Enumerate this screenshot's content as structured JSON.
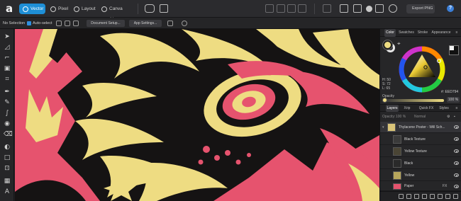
{
  "topbar": {
    "logo": "a",
    "personas": [
      "Vector",
      "Pixel",
      "Layout",
      "Canva AI"
    ],
    "export_label": "Export PNG",
    "help_label": "?"
  },
  "context": {
    "selection": "No Selection",
    "auto_select": "Auto-select",
    "document_setup": "Document Setup...",
    "app_settings": "App Settings..."
  },
  "color_panel": {
    "tabs": [
      "Color",
      "Swatches",
      "Stroke",
      "Appearance"
    ],
    "h": "H: 50",
    "s": "S: 72",
    "l": "L: 65",
    "hex": "#: EED794",
    "opacity_label": "Opacity",
    "opacity_value": "100 %",
    "fill_color": "#eedc82"
  },
  "layers_panel": {
    "tabs": [
      "Layers",
      "Xrip",
      "Quick FX",
      "Styles"
    ],
    "opacity_label": "Opacity:",
    "opacity_value": "100 %",
    "blend_mode": "Normal",
    "layers": [
      {
        "name": "Thylacene Poster - Will Sch..."
      },
      {
        "name": "Black Texture"
      },
      {
        "name": "Yellow Texture"
      },
      {
        "name": "Black"
      },
      {
        "name": "Yellow"
      },
      {
        "name": "Paper",
        "fx": "FX"
      }
    ]
  },
  "colors": {
    "accent": "#1e8fd6",
    "canvas_pink": "#e6536e",
    "canvas_yellow": "#eedc82",
    "canvas_black": "#151313"
  }
}
